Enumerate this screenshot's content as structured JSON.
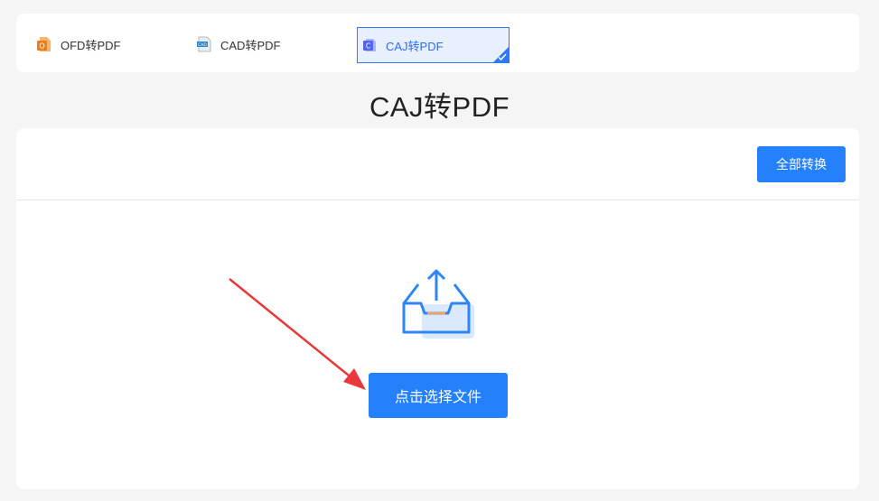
{
  "tabs": [
    {
      "label": "OFD转PDF",
      "icon": "ofd-file-icon",
      "active": false
    },
    {
      "label": "CAD转PDF",
      "icon": "cad-file-icon",
      "active": false
    },
    {
      "label": "CAJ转PDF",
      "icon": "caj-file-icon",
      "active": true
    }
  ],
  "page": {
    "title": "CAJ转PDF"
  },
  "toolbar": {
    "convert_all_label": "全部转换"
  },
  "upload": {
    "select_file_label": "点击选择文件",
    "icon": "upload-tray-icon"
  },
  "colors": {
    "accent": "#2580fb",
    "arrow": "#e8393a",
    "background": "#f5f5f5"
  }
}
